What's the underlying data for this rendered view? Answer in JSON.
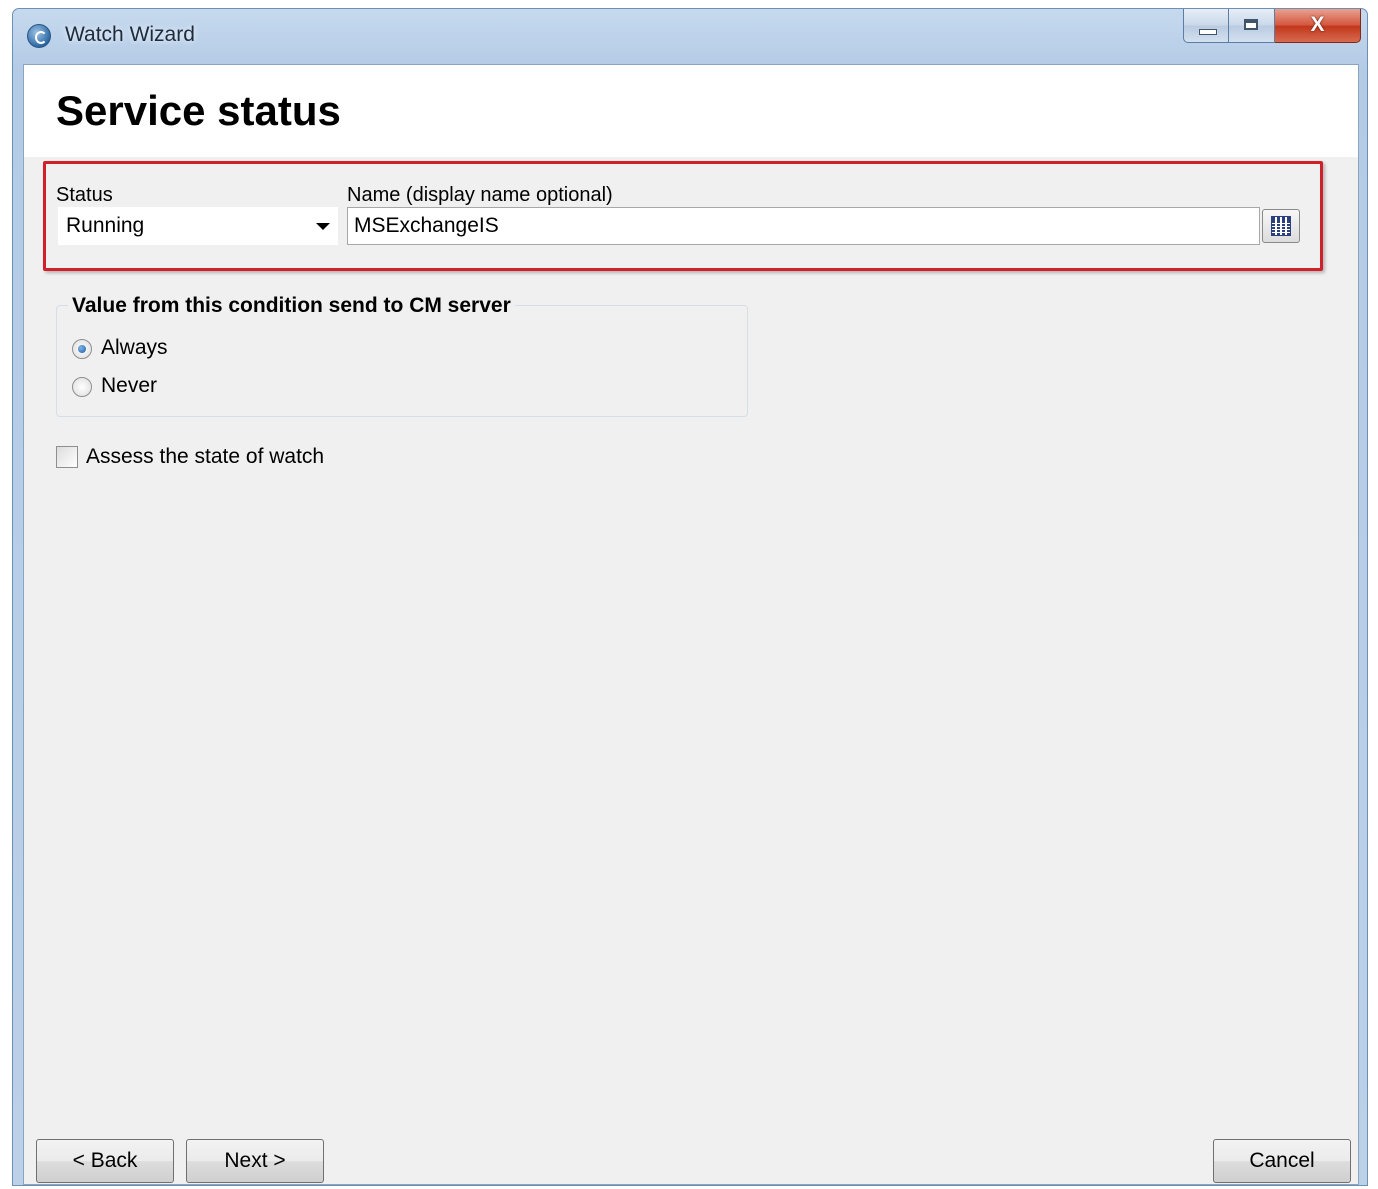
{
  "window": {
    "title": "Watch Wizard",
    "close_glyph": "X",
    "icon": "app-logo-icon"
  },
  "page": {
    "title": "Service status"
  },
  "status_field": {
    "label": "Status",
    "value": "Running"
  },
  "name_field": {
    "label": "Name (display name optional)",
    "value": "MSExchangeIS",
    "browse_icon": "browse-list-icon"
  },
  "send_group": {
    "title": "Value from this condition send to CM server",
    "options": [
      {
        "label": "Always",
        "selected": true
      },
      {
        "label": "Never",
        "selected": false
      }
    ]
  },
  "assess_checkbox": {
    "label": "Assess the state of watch",
    "checked": false
  },
  "footer": {
    "back_label": "< Back",
    "next_label": "Next >",
    "cancel_label": "Cancel"
  },
  "colors": {
    "highlight": "#d0212b",
    "client_bg": "#f0f0f0"
  }
}
